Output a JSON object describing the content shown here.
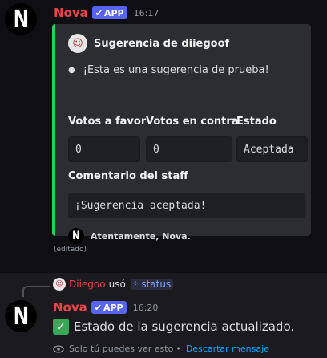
{
  "message1": {
    "author": "Nova",
    "badge": "APP",
    "time": "16:17",
    "avatar_letter": "N",
    "edited": "(editado)",
    "embed": {
      "accent_color": "#23d160",
      "author_name": "Sugerencia de diiegoof",
      "description": "¡Esta es una sugerencia de prueba!",
      "fields": [
        {
          "name": "Votos a favor",
          "value": "0"
        },
        {
          "name": "Votos en contra",
          "value": "0"
        },
        {
          "name": "Estado",
          "value": "Aceptada"
        }
      ],
      "comment_name": "Comentario del staff",
      "comment_value": "¡Sugerencia aceptada!",
      "footer_text": "Atentamente, Nova."
    }
  },
  "message2": {
    "reply_user": "Diiegoo",
    "reply_used": "usó",
    "reply_command": "status",
    "author": "Nova",
    "badge": "APP",
    "time": "16:20",
    "avatar_letter": "N",
    "content": "Estado de la sugerencia actualizado.",
    "ephemeral_text": "Solo tú puedes ver esto",
    "ephemeral_separator": "•",
    "dismiss_label": "Descartar mensaje"
  },
  "colors": {
    "author": "#e8454b",
    "badge": "#5865f2",
    "link": "#00a8fc"
  }
}
